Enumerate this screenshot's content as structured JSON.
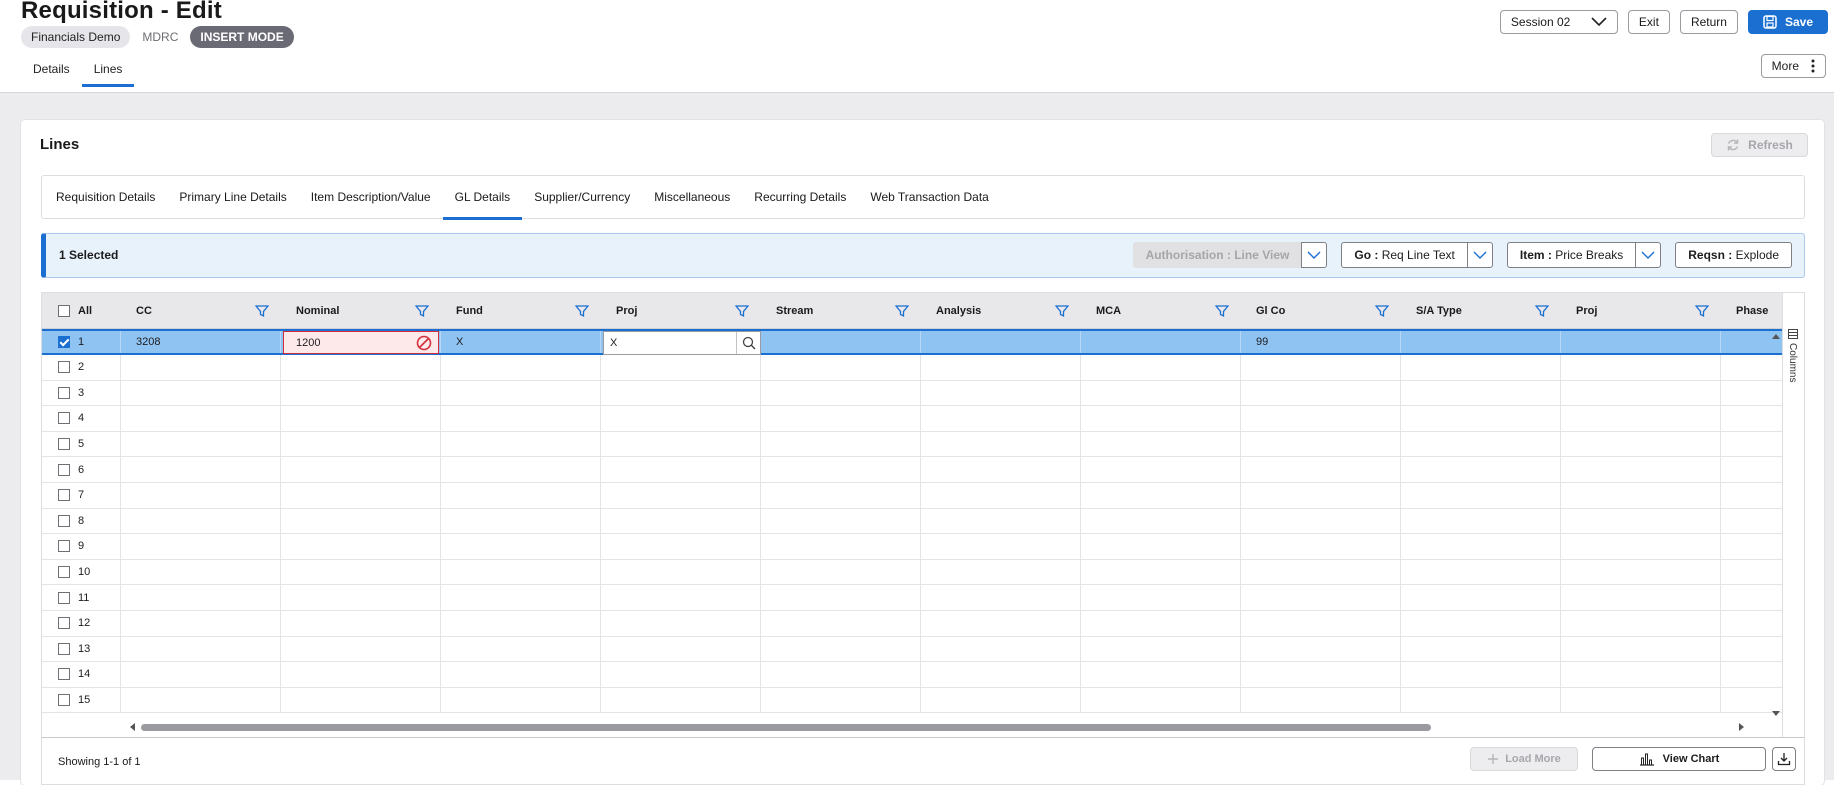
{
  "header": {
    "title": "Requisition - Edit",
    "company": "Financials Demo",
    "user": "MDRC",
    "mode": "INSERT MODE",
    "session": "Session 02",
    "exit": "Exit",
    "return": "Return",
    "save": "Save",
    "more": "More",
    "tabs": [
      "Details",
      "Lines"
    ]
  },
  "lines": {
    "title": "Lines",
    "refresh": "Refresh",
    "subtabs": [
      "Requisition Details",
      "Primary Line Details",
      "Item Description/Value",
      "GL Details",
      "Supplier/Currency",
      "Miscellaneous",
      "Recurring Details",
      "Web Transaction Data"
    ],
    "selected_text": "1 Selected",
    "actions": {
      "auth": "Authorisation : Line View",
      "go_prefix": "Go :",
      "go": "Req Line Text",
      "item_prefix": "Item :",
      "item": "Price Breaks",
      "reqsn_prefix": "Reqsn :",
      "reqsn": "Explode"
    }
  },
  "grid": {
    "all_label": "All",
    "columns": [
      "CC",
      "Nominal",
      "Fund",
      "Proj",
      "Stream",
      "Analysis",
      "MCA",
      "Gl Co",
      "S/A Type",
      "Proj",
      "Phase"
    ],
    "row_numbers": [
      "1",
      "2",
      "3",
      "4",
      "5",
      "6",
      "7",
      "8",
      "9",
      "10",
      "11",
      "12",
      "13",
      "14",
      "15"
    ],
    "row1": {
      "cc": "3208",
      "nominal": "1200",
      "fund": "X",
      "proj": "X",
      "glco": "99"
    },
    "columns_panel": "Columns",
    "showing": "Showing 1-1 of 1",
    "load_more": "Load More",
    "view_chart": "View Chart"
  },
  "colors": {
    "accent": "#1a6fd1",
    "selected_row": "#8fc3f2",
    "error": "#d32f3b"
  }
}
